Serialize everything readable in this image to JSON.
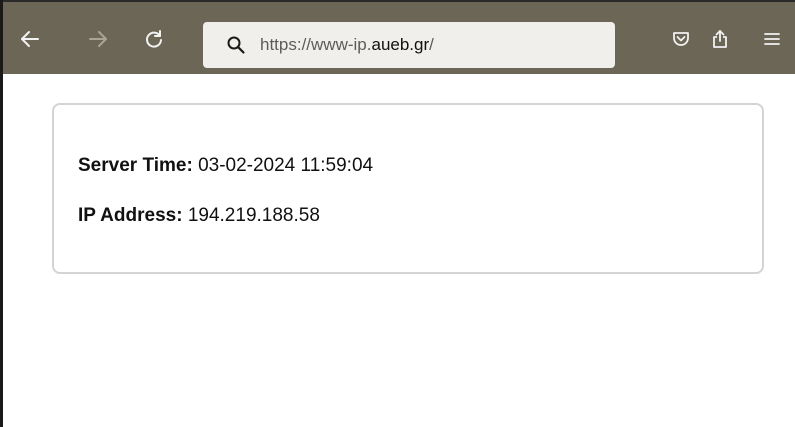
{
  "browser": {
    "toolbar_color": "#6b6656",
    "nav": {
      "back_icon": "arrow-left-icon",
      "forward_icon": "arrow-right-icon",
      "reload_icon": "reload-icon"
    },
    "url": {
      "scheme_prefix": "https://www-ip.",
      "host": "aueb.gr",
      "path": "/"
    },
    "actions": {
      "pocket_icon": "pocket-icon",
      "share_icon": "share-icon",
      "menu_icon": "hamburger-menu-icon"
    }
  },
  "page": {
    "server_time_label": "Server Time:",
    "server_time_value": "03-02-2024 11:59:04",
    "ip_label": "IP Address:",
    "ip_value": "194.219.188.58"
  }
}
